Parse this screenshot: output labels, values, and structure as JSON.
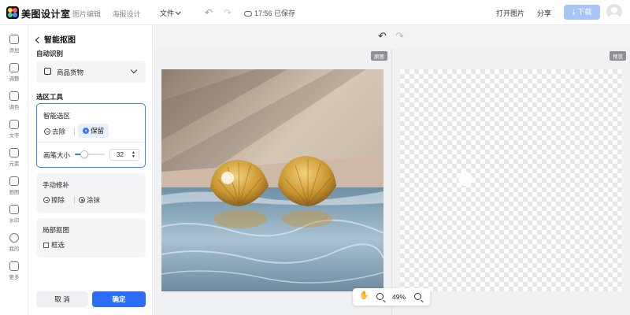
{
  "app": {
    "brand": "美图设计室",
    "nav": [
      "图片编辑",
      "海报设计"
    ],
    "file_menu": "文件",
    "save_status": "17:56 已保存",
    "open_image": "打开图片",
    "share": "分享",
    "download": "下载"
  },
  "rail": [
    {
      "label": "添加",
      "icon": "plus-icon"
    },
    {
      "label": "调整",
      "icon": "sliders-icon"
    },
    {
      "label": "调色",
      "icon": "magic-wand-icon"
    },
    {
      "label": "文字",
      "icon": "text-icon"
    },
    {
      "label": "元素",
      "icon": "shapes-icon"
    },
    {
      "label": "画图",
      "icon": "pencil-icon"
    },
    {
      "label": "水印",
      "icon": "stamp-icon"
    },
    {
      "label": "我的",
      "icon": "user-icon"
    },
    {
      "label": "更多",
      "icon": "cube-icon"
    }
  ],
  "panel": {
    "title": "智能抠图",
    "auto_section": "自动识别",
    "auto_value": "商品货物",
    "tools_section": "选区工具",
    "smart_select": {
      "title": "智能选区",
      "remove": "去除",
      "keep": "保留",
      "brush_label": "画笔大小",
      "brush_value": "32",
      "brush_fraction": 0.32
    },
    "manual": {
      "title": "手动修补",
      "erase": "擦除",
      "paint": "涂抹"
    },
    "local": {
      "title": "局部抠图",
      "box": "框选"
    },
    "cancel": "取 消",
    "confirm": "确定"
  },
  "canvas": {
    "original_tag": "原图",
    "preview_tag": "预览",
    "zoom": "49%"
  }
}
